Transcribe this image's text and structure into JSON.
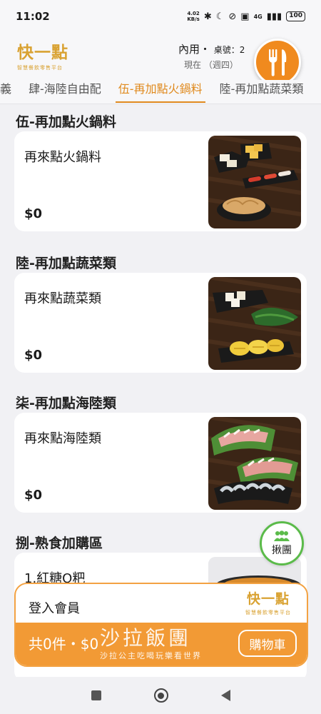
{
  "status_bar": {
    "time": "11:02",
    "net_speed": "4.02",
    "net_unit": "KB/s",
    "network": "4G",
    "battery": "100"
  },
  "header": {
    "logo": "快一點",
    "logo_sub": "智慧餐飲零售平台",
    "dine_mode": "內用・",
    "table_label": "桌號：2",
    "time_label": "現在 （週四）"
  },
  "tabs": [
    "義",
    "肆-海陸自由配",
    "伍-再加點火鍋料",
    "陸-再加點蔬菜類"
  ],
  "active_tab_index": 2,
  "sections": [
    {
      "title": "伍-再加點火鍋料",
      "item": "再來點火鍋料",
      "price": "$0"
    },
    {
      "title": "陸-再加點蔬菜類",
      "item": "再來點蔬菜類",
      "price": "$0"
    },
    {
      "title": "柒-再加點海陸類",
      "item": "再來點海陸類",
      "price": "$0"
    },
    {
      "title": "捌-熟食加購區",
      "item": "1.紅糖Q粑"
    }
  ],
  "group_button": {
    "label": "揪團"
  },
  "cart": {
    "member_login": "登入會員",
    "summary": "共0件・$0",
    "button": "購物車",
    "watermark_main": "沙拉飯團",
    "watermark_sub": "沙拉公主吃喝玩樂看世界"
  },
  "colors": {
    "accent": "#f29a35",
    "tab_active": "#e08a1e",
    "logo": "#d9a232",
    "group_ring": "#5bbb4a"
  }
}
